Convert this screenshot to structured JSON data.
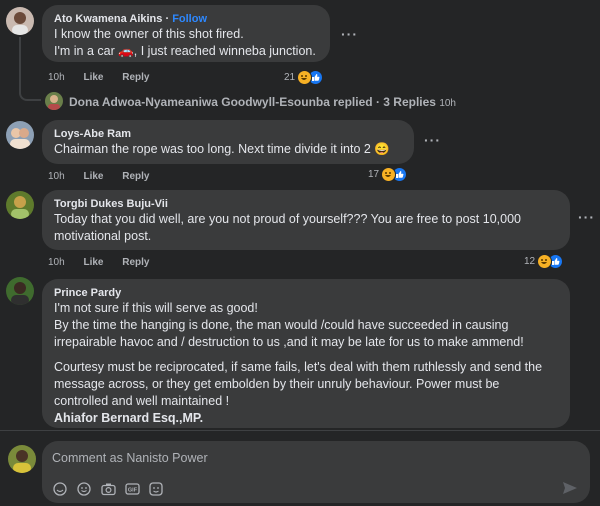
{
  "comments": [
    {
      "author": "Ato Kwamena Aikins",
      "follow": "Follow",
      "lines": [
        "I know the owner of this shot fired.",
        "I'm in a car 🚗, I just reached winneba junction."
      ],
      "time": "10h",
      "like": "Like",
      "reply": "Reply",
      "reactions": "21"
    },
    {
      "author": "Loys-Abe Ram",
      "lines": [
        "Chairman the rope was too long. Next time divide it into 2 😄"
      ],
      "time": "10h",
      "like": "Like",
      "reply": "Reply",
      "reactions": "17"
    },
    {
      "author": "Torgbi Dukes Buju-Vii",
      "lines": [
        "Today that you did well, are you not proud of yourself??? You are free to post 10,000",
        "motivational post."
      ],
      "time": "10h",
      "like": "Like",
      "reply": "Reply",
      "reactions": "12"
    },
    {
      "author": "Prince Pardy",
      "lines": [
        "I'm not sure if this will serve as good!",
        "By the time the hanging is done, the man would /could have succeeded in causing",
        "irrepairable havoc and / destruction to us ,and it may be late for us to make ammend!"
      ],
      "lines2": [
        "Courtesy must be reciprocated, if same fails, let's deal with them ruthlessly and send the",
        "message across, or they get embolden by their unruly behaviour. Power must be",
        "controlled and well maintained !"
      ],
      "signature": "Ahiafor Bernard Esq.,MP."
    }
  ],
  "replies_summary": {
    "text": "Dona Adwoa-Nyameaniwa Goodwyll-Esounba replied · 3 Replies",
    "time": "10h"
  },
  "composer": {
    "placeholder": "Comment as Nanisto Power",
    "tools": [
      "sticker-icon",
      "emoji-icon",
      "camera-icon",
      "gif-icon",
      "avatar-sticker-icon"
    ]
  },
  "colors": {
    "background": "#242526",
    "bubble": "#3a3b3c",
    "accent": "#2d88ff",
    "muted": "#b0b3b8"
  }
}
